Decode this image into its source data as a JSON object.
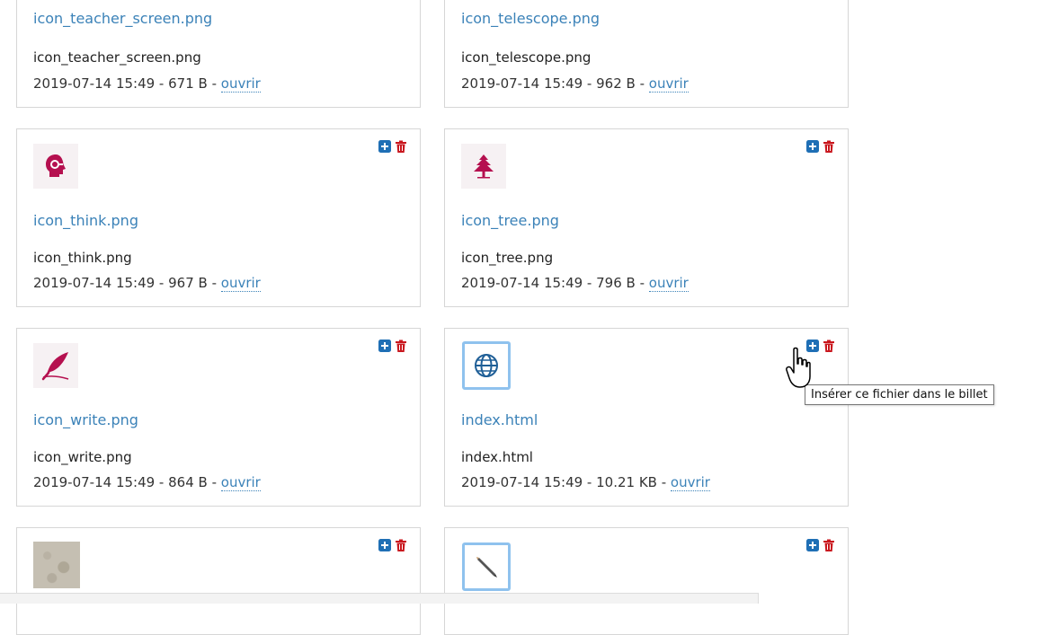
{
  "colors": {
    "link": "#3b82b8",
    "insert_icon": "#1f6fb5",
    "delete_icon": "#c9171e",
    "icon_magenta": "#b5104f",
    "doc_border": "#8fc2ee"
  },
  "actions": {
    "insert_icon": "plus-square-icon",
    "delete_icon": "trash-icon"
  },
  "files": [
    {
      "title": "icon_teacher_screen.png",
      "name": "icon_teacher_screen.png",
      "meta": "2019-07-14 15:49 - 671 B - ",
      "open_label": "ouvrir",
      "thumb_icon": ""
    },
    {
      "title": "icon_telescope.png",
      "name": "icon_telescope.png",
      "meta": "2019-07-14 15:49 - 962 B - ",
      "open_label": "ouvrir",
      "thumb_icon": ""
    },
    {
      "title": "icon_think.png",
      "name": "icon_think.png",
      "meta": "2019-07-14 15:49 - 967 B - ",
      "open_label": "ouvrir",
      "thumb_icon": "head-idea-icon"
    },
    {
      "title": "icon_tree.png",
      "name": "icon_tree.png",
      "meta": "2019-07-14 15:49 - 796 B - ",
      "open_label": "ouvrir",
      "thumb_icon": "tree-icon"
    },
    {
      "title": "icon_write.png",
      "name": "icon_write.png",
      "meta": "2019-07-14 15:49 - 864 B - ",
      "open_label": "ouvrir",
      "thumb_icon": "quill-icon"
    },
    {
      "title": "index.html",
      "name": "index.html",
      "meta": "2019-07-14 15:49 - 10.21 KB - ",
      "open_label": "ouvrir",
      "thumb_icon": "globe-icon"
    },
    {
      "thumb_icon": "photo-thumbnail"
    },
    {
      "thumb_icon": "pencil-icon"
    }
  ],
  "tooltip": {
    "text": "Insérer ce fichier dans le billet"
  }
}
